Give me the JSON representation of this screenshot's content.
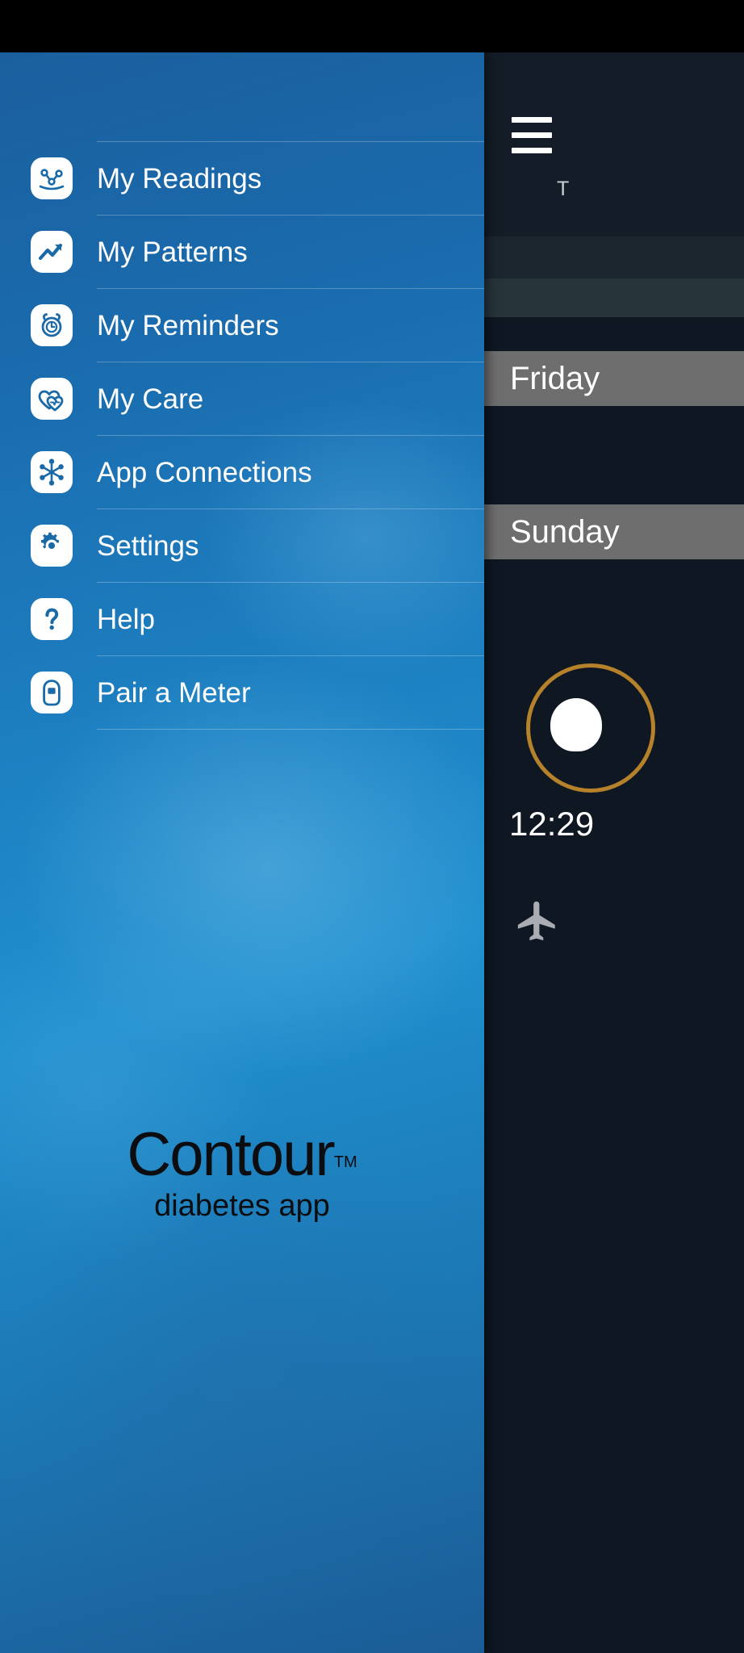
{
  "status_bar": {
    "background": "#000000"
  },
  "app_screen": {
    "background": "#0e1722",
    "hamburger_icon": "hamburger-menu-icon",
    "topbar_title": "T",
    "day_banners": [
      {
        "label": "Friday"
      },
      {
        "label": "Sunday"
      }
    ],
    "reading": {
      "ring_color": "#b5812a",
      "time": "12:29"
    },
    "airplane_icon": "airplane-mode-icon"
  },
  "drawer": {
    "accent_color": "#1d81c2",
    "items": [
      {
        "label": "My Readings",
        "icon": "readings-graph-icon"
      },
      {
        "label": "My Patterns",
        "icon": "patterns-trend-icon"
      },
      {
        "label": "My Reminders",
        "icon": "alarm-clock-icon"
      },
      {
        "label": "My Care",
        "icon": "hearts-icon"
      },
      {
        "label": "App Connections",
        "icon": "hub-spoke-icon"
      },
      {
        "label": "Settings",
        "icon": "gear-icon"
      },
      {
        "label": "Help",
        "icon": "question-mark-icon"
      },
      {
        "label": "Pair a Meter",
        "icon": "glucose-meter-icon"
      }
    ],
    "brand": {
      "name": "Contour",
      "trademark": "TM",
      "tagline": "diabetes app"
    }
  }
}
